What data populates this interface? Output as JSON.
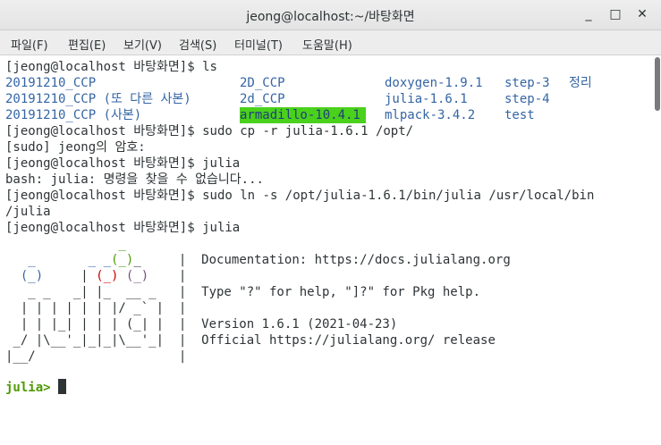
{
  "window": {
    "title": "jeong@localhost:~/바탕화면",
    "minimize_glyph": "_",
    "maximize_glyph": "□",
    "close_glyph": "✕"
  },
  "menu": [
    "파일(F)",
    "편집(E)",
    "보기(V)",
    "검색(S)",
    "터미널(T)",
    "도움말(H)"
  ],
  "terminal": {
    "l1": "[jeong@localhost 바탕화면]$ ls",
    "ls": {
      "c1": [
        "20191210_CCP",
        "20191210_CCP (또 다른 사본)",
        "20191210_CCP (사본)"
      ],
      "c2": [
        "2D_CCP",
        "2d_CCP",
        "armadillo-10.4.1"
      ],
      "c3": [
        "doxygen-1.9.1",
        "julia-1.6.1",
        "mlpack-3.4.2"
      ],
      "c4": [
        "step-3",
        "step-4",
        "test"
      ],
      "c5": "정리"
    },
    "l5": "[jeong@localhost 바탕화면]$ sudo cp -r julia-1.6.1 /opt/",
    "l6": "[sudo] jeong의 암호:",
    "l7": "[jeong@localhost 바탕화면]$ julia",
    "l8": "bash: julia: 명령을 찾을 수 없습니다...",
    "l9": "[jeong@localhost 바탕화면]$ sudo ln -s /opt/julia-1.6.1/bin/julia /usr/local/bin",
    "l10": "/julia",
    "l11": "[jeong@localhost 바탕화면]$ julia",
    "banner": {
      "r1": "               _",
      "r2a": "   _       _ _",
      "r2b": "(_)",
      "r2c": "_     |  Documentation: https://docs.julialang.org",
      "r3a": "  ",
      "r3b": "(_)",
      "r3c": "     | ",
      "r3d": "(_)",
      "r3e": " ",
      "r3f": "(_)",
      "r3g": "    |",
      "r4": "   _ _   _| |_  __ _   |  Type \"?\" for help, \"]?\" for Pkg help.",
      "r5": "  | | | | | | |/ _` |  |",
      "r6": "  | | |_| | | | (_| |  |  Version 1.6.1 (2021-04-23)",
      "r7": " _/ |\\__'_|_|_|\\__'_|  |  Official https://julialang.org/ release",
      "r8": "|__/                   |"
    },
    "prompt": "julia>"
  }
}
